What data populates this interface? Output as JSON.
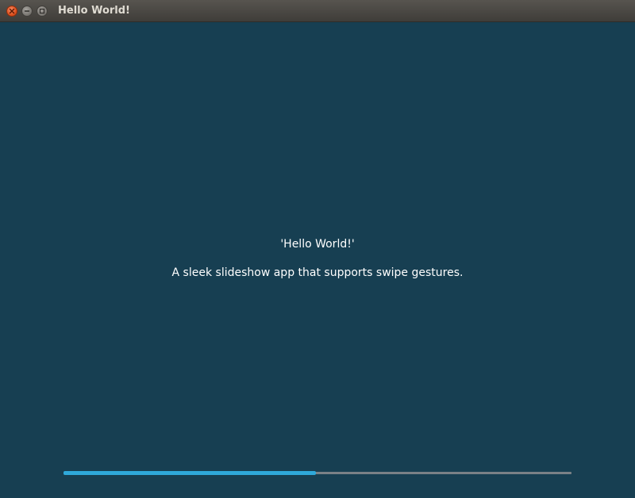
{
  "window": {
    "title": "Hello World!",
    "controls": [
      {
        "name": "close-icon"
      },
      {
        "name": "minimize-icon"
      },
      {
        "name": "maximize-icon"
      }
    ]
  },
  "slide": {
    "title": "'Hello World!'",
    "text": "A sleek slideshow app that supports swipe gestures."
  },
  "progress": {
    "fraction": 0.497
  },
  "colors": {
    "background": "#173f52",
    "accent": "#2fa9da",
    "track": "#7a8186"
  }
}
